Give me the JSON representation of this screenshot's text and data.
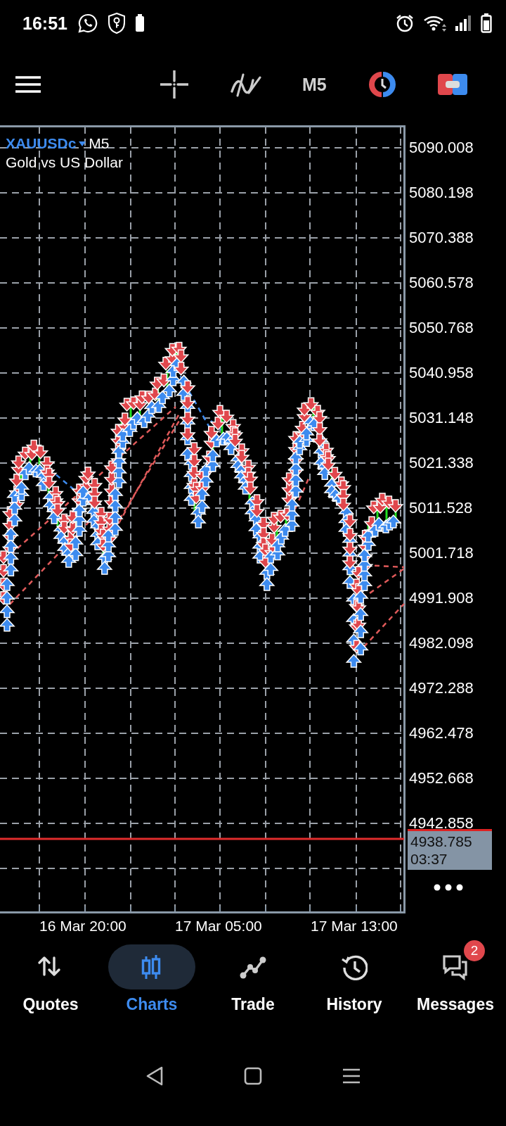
{
  "status_bar": {
    "time": "16:51"
  },
  "toolbar": {
    "timeframe": "M5"
  },
  "chart": {
    "symbol": "XAUUSDc",
    "timeframe": "M5",
    "description": "Gold vs US Dollar",
    "price_labels": [
      "5090.008",
      "5080.198",
      "5070.388",
      "5060.578",
      "5050.768",
      "5040.958",
      "5031.148",
      "5021.338",
      "5011.528",
      "5001.718",
      "4991.908",
      "4982.098",
      "4972.288",
      "4962.478",
      "4952.668",
      "4942.858"
    ],
    "time_labels": [
      "16 Mar 20:00",
      "17 Mar 05:00",
      "17 Mar 13:00"
    ],
    "current_price": {
      "price": "4938.785",
      "countdown": "03:37"
    }
  },
  "bottom_nav": [
    {
      "kind": "quotes",
      "label": "Quotes",
      "selected": false
    },
    {
      "kind": "charts",
      "label": "Charts",
      "selected": true
    },
    {
      "kind": "trade",
      "label": "Trade",
      "selected": false
    },
    {
      "kind": "history",
      "label": "History",
      "selected": false
    },
    {
      "kind": "messages",
      "label": "Messages",
      "selected": false,
      "badge": "2"
    }
  ]
}
